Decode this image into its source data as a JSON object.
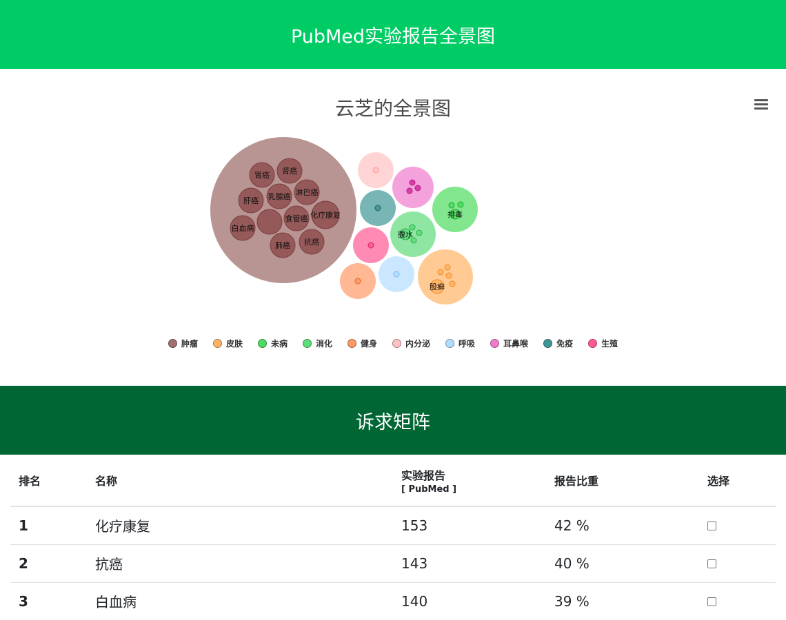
{
  "header": {
    "title": "PubMed实验报告全景图"
  },
  "chart_data": {
    "type": "bubble",
    "title": "云芝的全景图",
    "legend": [
      {
        "name": "肿瘤",
        "color": "#a0706f"
      },
      {
        "name": "皮肤",
        "color": "#ffb366"
      },
      {
        "name": "未病",
        "color": "#4ddc5f"
      },
      {
        "name": "消化",
        "color": "#5fdc7a"
      },
      {
        "name": "健身",
        "color": "#ff9966"
      },
      {
        "name": "内分泌",
        "color": "#ffc2c2"
      },
      {
        "name": "呼吸",
        "color": "#b3ddff"
      },
      {
        "name": "耳鼻喉",
        "color": "#f07acc"
      },
      {
        "name": "免疫",
        "color": "#3f9696"
      },
      {
        "name": "生殖",
        "color": "#ff5a94"
      }
    ],
    "groups": [
      {
        "category": "肿瘤",
        "items": [
          "胃癌",
          "肾癌",
          "淋巴癌",
          "乳腺癌",
          "肝癌",
          "化疗康复",
          "食管癌",
          "白血病",
          "",
          "抗癌",
          "肺癌"
        ]
      },
      {
        "category": "内分泌",
        "items": [
          ""
        ]
      },
      {
        "category": "耳鼻喉",
        "items": [
          "",
          "",
          ""
        ]
      },
      {
        "category": "未病",
        "items": [
          "排毒",
          "",
          ""
        ]
      },
      {
        "category": "免疫",
        "items": [
          ""
        ]
      },
      {
        "category": "消化",
        "items": [
          "腹水",
          "",
          "",
          ""
        ]
      },
      {
        "category": "生殖",
        "items": [
          ""
        ]
      },
      {
        "category": "健身",
        "items": [
          ""
        ]
      },
      {
        "category": "呼吸",
        "items": [
          ""
        ]
      },
      {
        "category": "皮肤",
        "items": [
          "股癣",
          "",
          "",
          "",
          ""
        ]
      }
    ]
  },
  "menu": {
    "icon": "hamburger-menu-icon"
  },
  "section": {
    "title": "诉求矩阵"
  },
  "table": {
    "headers": {
      "rank": "排名",
      "name": "名称",
      "reports": "实验报告",
      "reports_sub": "[ PubMed ]",
      "ratio": "报告比重",
      "select": "选择"
    },
    "rows": [
      {
        "rank": "1",
        "name": "化疗康复",
        "reports": "153",
        "ratio": "42 %"
      },
      {
        "rank": "2",
        "name": "抗癌",
        "reports": "143",
        "ratio": "40 %"
      },
      {
        "rank": "3",
        "name": "白血病",
        "reports": "140",
        "ratio": "39 %"
      }
    ]
  }
}
